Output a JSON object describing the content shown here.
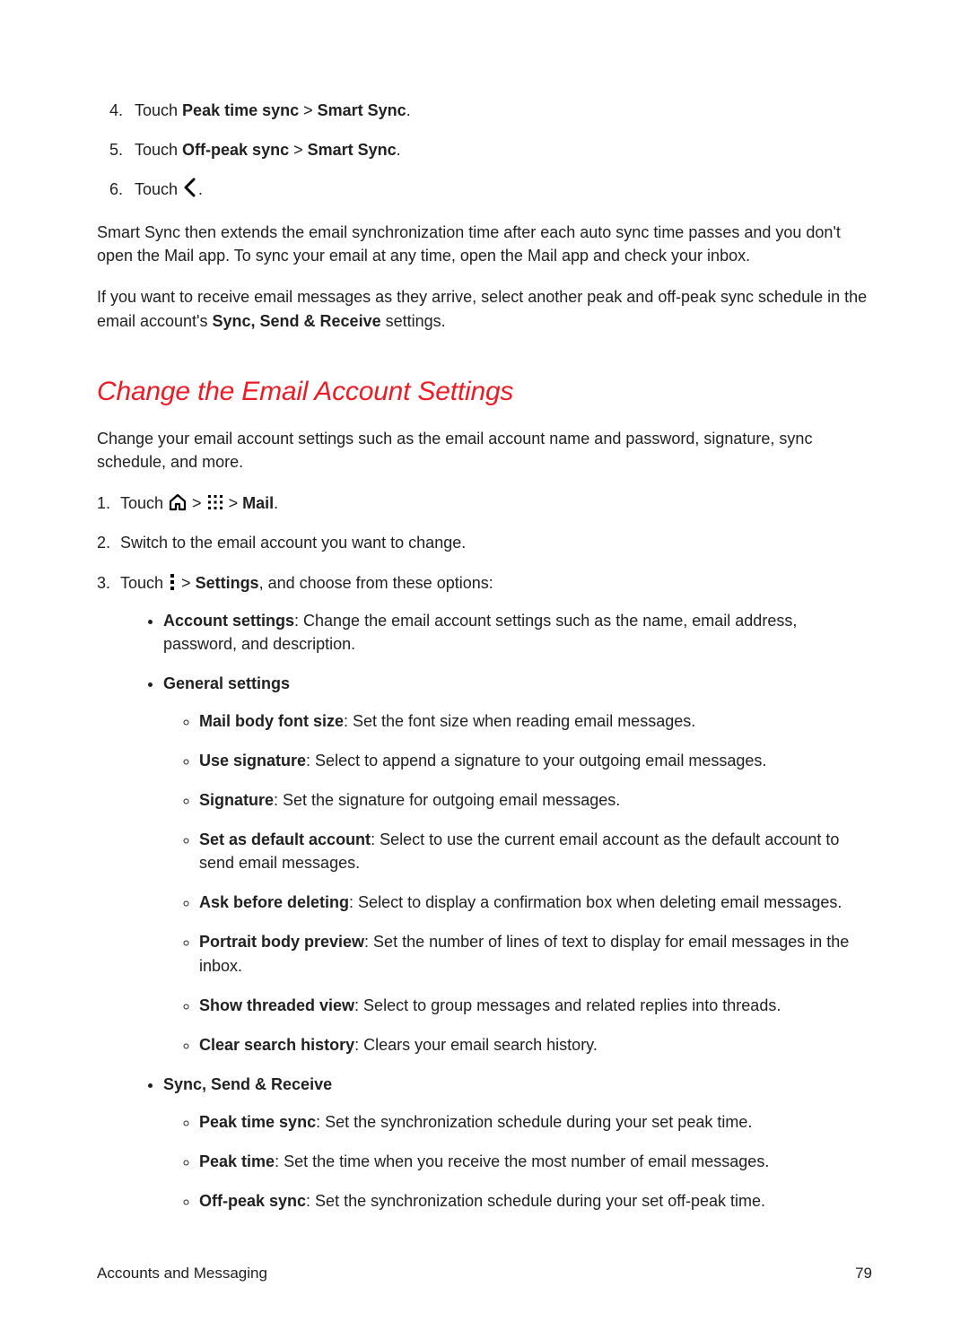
{
  "steps_top": [
    {
      "prefix": "Touch ",
      "b1": "Peak time sync",
      "mid": " > ",
      "b2": "Smart Sync",
      "suffix": "."
    },
    {
      "prefix": "Touch ",
      "b1": "Off-peak sync",
      "mid": " > ",
      "b2": "Smart Sync",
      "suffix": "."
    },
    {
      "prefix": "Touch ",
      "suffix": "."
    }
  ],
  "para1": "Smart Sync then extends the email synchronization time after each auto sync time passes and you don't open the Mail app. To sync your email at any time, open the Mail app and check your inbox.",
  "para2_a": "If you want to receive email messages as they arrive, select another peak and off-peak sync schedule in the email account's ",
  "para2_b": "Sync, Send & Receive",
  "para2_c": " settings.",
  "heading": "Change the Email Account Settings",
  "para3": "Change your email account settings such as the email account name and password, signature, sync schedule, and more.",
  "step1_prefix": "Touch ",
  "step1_gt1": " > ",
  "step1_gt2": " > ",
  "step1_mail": "Mail",
  "step1_suffix": ".",
  "step2": "Switch to the email account you want to change.",
  "step3_prefix": "Touch ",
  "step3_gt": " > ",
  "step3_settings": "Settings",
  "step3_suffix": ", and choose from these options:",
  "bullets": {
    "account_b": "Account settings",
    "account_t": ": Change the email account settings such as the name, email address, password, and description.",
    "general_b": "General settings",
    "general_items": [
      {
        "b": "Mail body font size",
        "t": ": Set the font size when reading email messages."
      },
      {
        "b": "Use signature",
        "t": ": Select to append a signature to your outgoing email messages."
      },
      {
        "b": "Signature",
        "t": ": Set the signature for outgoing email messages."
      },
      {
        "b": "Set as default account",
        "t": ": Select to use the current email account as the default account to send email messages."
      },
      {
        "b": "Ask before deleting",
        "t": ": Select to display a confirmation box when deleting email messages."
      },
      {
        "b": "Portrait body preview",
        "t": ": Set the number of lines of text to display for email messages in the inbox."
      },
      {
        "b": "Show threaded view",
        "t": ": Select to group messages and related replies into threads."
      },
      {
        "b": "Clear search history",
        "t": ": Clears your email search history."
      }
    ],
    "sync_b": "Sync, Send & Receive",
    "sync_items": [
      {
        "b": "Peak time sync",
        "t": ": Set the synchronization schedule during your set peak time."
      },
      {
        "b": "Peak time",
        "t": ": Set the time when you receive the most number of email messages."
      },
      {
        "b": "Off-peak sync",
        "t": ": Set the synchronization schedule during your set off-peak time."
      }
    ]
  },
  "footer_left": "Accounts and Messaging",
  "footer_right": "79"
}
